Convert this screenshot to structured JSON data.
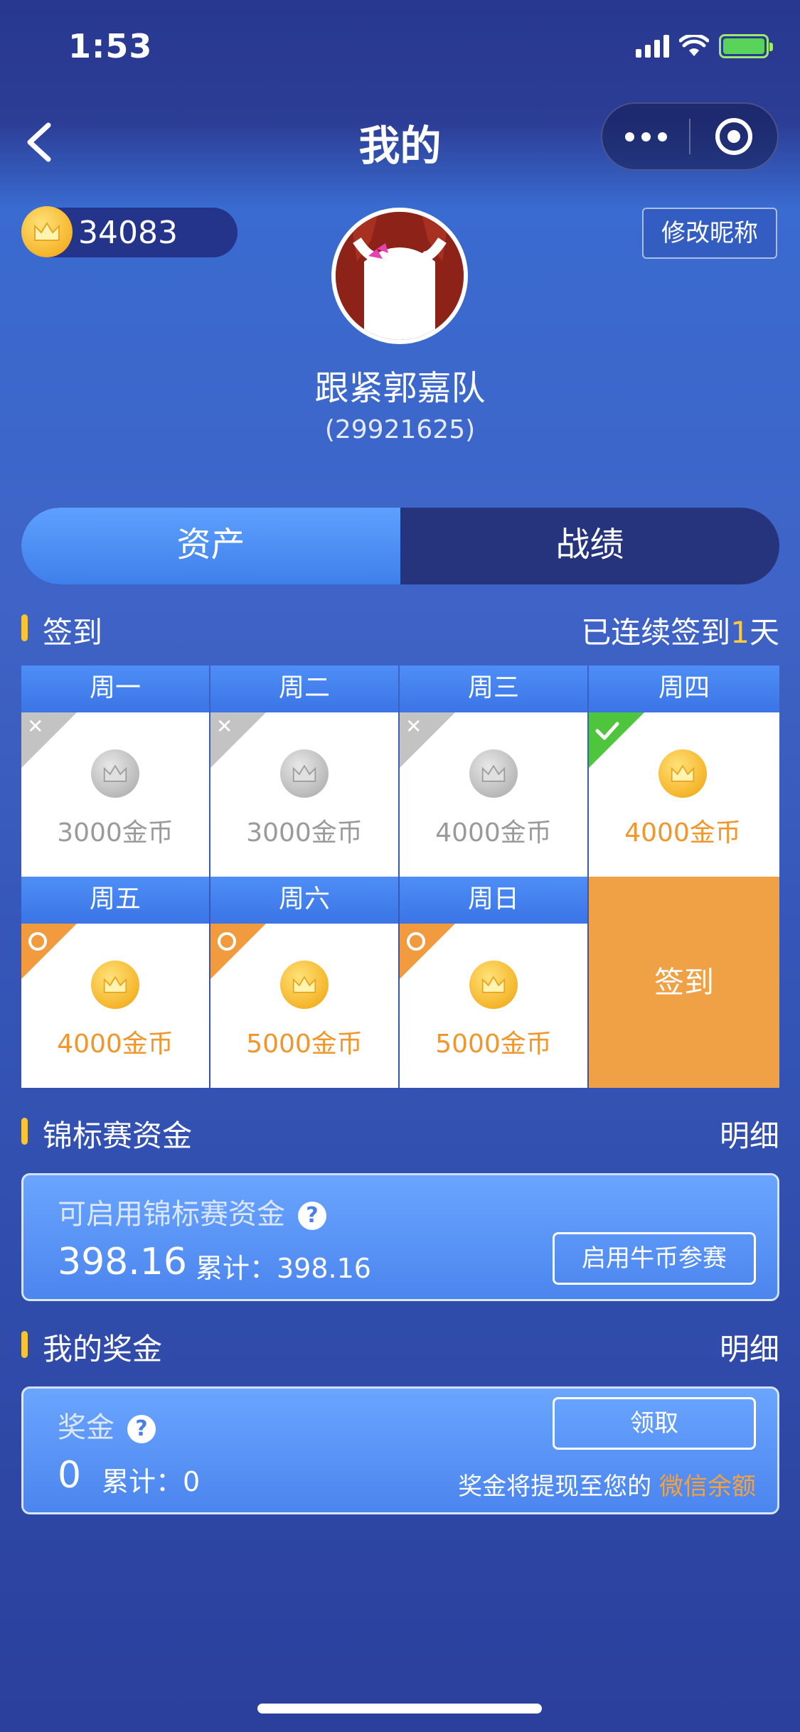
{
  "status_bar": {
    "time": "1:53"
  },
  "nav": {
    "title": "我的"
  },
  "profile": {
    "coins": "34083",
    "edit_label": "修改昵称",
    "nickname": "跟紧郭嘉队",
    "uid": "(29921625)"
  },
  "tabs": [
    {
      "label": "资产",
      "active": true
    },
    {
      "label": "战绩",
      "active": false
    }
  ],
  "signin_section": {
    "title": "签到",
    "streak_prefix": "已连续签到",
    "streak_days": "1",
    "streak_suffix": "天",
    "days": [
      {
        "day": "周一",
        "amount": "3000金币",
        "state": "missed"
      },
      {
        "day": "周二",
        "amount": "3000金币",
        "state": "missed"
      },
      {
        "day": "周三",
        "amount": "4000金币",
        "state": "missed"
      },
      {
        "day": "周四",
        "amount": "4000金币",
        "state": "done"
      },
      {
        "day": "周五",
        "amount": "4000金币",
        "state": "pending"
      },
      {
        "day": "周六",
        "amount": "5000金币",
        "state": "pending"
      },
      {
        "day": "周日",
        "amount": "5000金币",
        "state": "pending"
      }
    ],
    "button_label": "签到"
  },
  "championship": {
    "title": "锦标赛资金",
    "detail_link": "明细",
    "label": "可启用锦标赛资金",
    "value": "398.16",
    "cumulative": "累计：398.16",
    "button": "启用牛币参赛"
  },
  "bonus": {
    "title": "我的奖金",
    "detail_link": "明细",
    "label": "奖金",
    "value": "0",
    "cumulative": "累计：0",
    "button": "领取",
    "note_prefix": "奖金将提现至您的",
    "note_highlight": "微信余额"
  },
  "colors": {
    "accent_gold": "#f8c434",
    "orange": "#f0a045",
    "green_check": "#4fc53d",
    "tab_active": "#4f8ff6",
    "tab_inactive": "#26347e"
  }
}
